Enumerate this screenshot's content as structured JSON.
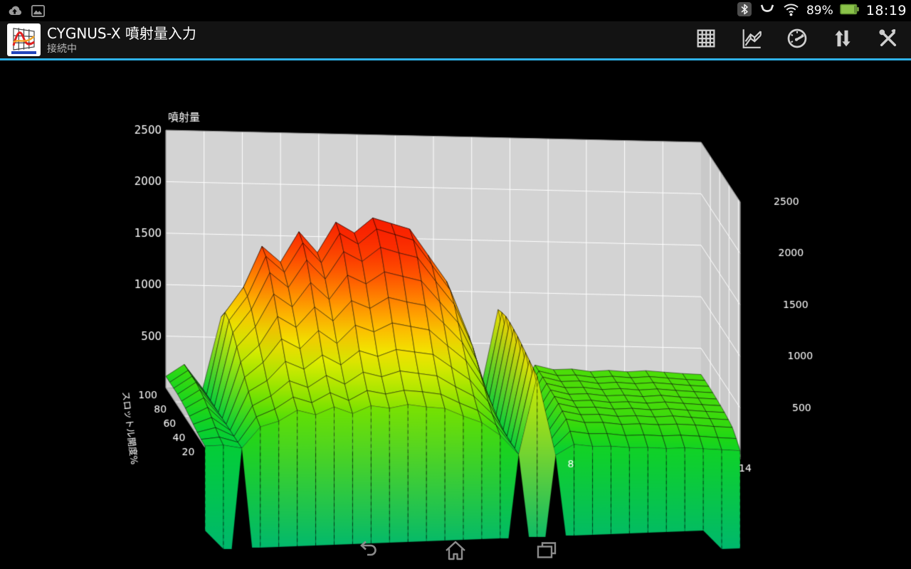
{
  "status_bar": {
    "time": "18:19",
    "battery_percent": "89%",
    "left_icons": [
      "cloud-upload",
      "gallery"
    ],
    "right_icons": [
      "bluetooth",
      "connected-device",
      "wifi",
      "battery"
    ]
  },
  "app_bar": {
    "title": "CYGNUS-X 噴射量入力",
    "subtitle": "接続中",
    "accent_color": "#2fb2e8",
    "actions": [
      {
        "name": "table-view",
        "icon": "grid-icon"
      },
      {
        "name": "surface-chart-view",
        "icon": "surface-chart-icon"
      },
      {
        "name": "gauge-view",
        "icon": "gauge-icon"
      },
      {
        "name": "transfer-data",
        "icon": "up-down-arrows-icon"
      },
      {
        "name": "settings-tools",
        "icon": "tools-icon"
      }
    ]
  },
  "nav_bar": {
    "buttons": [
      "back",
      "home",
      "recents"
    ]
  },
  "chart_data": {
    "type": "surface",
    "title": "噴射量",
    "value_axis": {
      "label": "噴射量",
      "ticks": [
        2500,
        2000,
        1500,
        1000,
        500
      ],
      "min": 0,
      "max": 2500
    },
    "rpm_axis": {
      "ticks": [
        {
          "label": "8",
          "frac": 0.674
        },
        {
          "label": "14",
          "frac": 1.0
        }
      ],
      "gridline_count": 14
    },
    "throttle_axis": {
      "label": "スロットル開度%",
      "ticks": [
        100,
        80,
        60,
        40,
        20
      ]
    },
    "throttle_rows": [
      100,
      90,
      80,
      70,
      60,
      50,
      40,
      30,
      20,
      10,
      0
    ],
    "values": [
      [
        110,
        230,
        0,
        700,
        920,
        1280,
        1140,
        1410,
        1230,
        1500,
        1410,
        1540,
        1500,
        1450,
        1230,
        1010,
        620,
        0,
        830,
        0,
        300,
        260,
        270,
        250,
        265,
        255,
        270,
        260,
        250,
        245
      ],
      [
        110,
        230,
        0,
        800,
        1050,
        1450,
        1300,
        1600,
        1400,
        1700,
        1600,
        1750,
        1700,
        1650,
        1400,
        1150,
        700,
        0,
        860,
        0,
        300,
        260,
        270,
        250,
        265,
        255,
        270,
        260,
        250,
        245
      ],
      [
        110,
        230,
        0,
        780,
        1020,
        1410,
        1260,
        1550,
        1360,
        1650,
        1550,
        1700,
        1650,
        1600,
        1360,
        1120,
        680,
        0,
        880,
        0,
        300,
        260,
        270,
        250,
        265,
        255,
        270,
        260,
        250,
        245
      ],
      [
        110,
        230,
        0,
        720,
        950,
        1310,
        1170,
        1440,
        1260,
        1530,
        1440,
        1580,
        1530,
        1490,
        1260,
        1040,
        630,
        0,
        880,
        0,
        295,
        258,
        266,
        248,
        262,
        252,
        266,
        256,
        248,
        242
      ],
      [
        100,
        215,
        0,
        640,
        840,
        1160,
        1040,
        1280,
        1120,
        1360,
        1280,
        1400,
        1360,
        1320,
        1120,
        920,
        560,
        0,
        870,
        0,
        290,
        252,
        262,
        245,
        256,
        246,
        262,
        250,
        244,
        238
      ],
      [
        90,
        195,
        0,
        550,
        720,
        1000,
        900,
        1100,
        970,
        1170,
        1100,
        1210,
        1170,
        1140,
        970,
        790,
        480,
        0,
        860,
        0,
        285,
        246,
        256,
        240,
        250,
        240,
        256,
        246,
        238,
        232
      ],
      [
        70,
        160,
        0,
        460,
        610,
        840,
        750,
        930,
        810,
        990,
        930,
        1020,
        990,
        960,
        810,
        670,
        410,
        0,
        840,
        0,
        275,
        240,
        248,
        232,
        244,
        234,
        248,
        238,
        230,
        224
      ],
      [
        50,
        120,
        0,
        380,
        490,
        680,
        610,
        750,
        660,
        800,
        750,
        820,
        800,
        780,
        660,
        540,
        330,
        0,
        820,
        0,
        260,
        228,
        236,
        220,
        230,
        222,
        236,
        226,
        218,
        212
      ],
      [
        30,
        80,
        0,
        300,
        400,
        550,
        490,
        610,
        530,
        650,
        610,
        670,
        650,
        630,
        530,
        440,
        270,
        0,
        800,
        0,
        240,
        210,
        215,
        200,
        210,
        205,
        215,
        210,
        200,
        195
      ],
      [
        20,
        45,
        0,
        250,
        330,
        450,
        400,
        500,
        430,
        530,
        500,
        540,
        530,
        510,
        430,
        360,
        220,
        0,
        780,
        0,
        180,
        160,
        165,
        150,
        160,
        155,
        165,
        160,
        150,
        145
      ],
      [
        12,
        25,
        0,
        210,
        270,
        380,
        340,
        420,
        360,
        440,
        420,
        460,
        440,
        430,
        360,
        300,
        180,
        0,
        760,
        0,
        110,
        95,
        100,
        90,
        95,
        90,
        100,
        95,
        90,
        85
      ]
    ],
    "colormap": [
      [
        0,
        "#00cd3c"
      ],
      [
        150,
        "#1ed714"
      ],
      [
        350,
        "#6ee100"
      ],
      [
        550,
        "#b4e600"
      ],
      [
        750,
        "#eeee00"
      ],
      [
        950,
        "#ffc300"
      ],
      [
        1150,
        "#ff8c00"
      ],
      [
        1350,
        "#ff5500"
      ],
      [
        1550,
        "#fc2d00"
      ],
      [
        1800,
        "#f51900"
      ]
    ],
    "colors": {
      "background": "#000000",
      "back_wall": "#d3d3d3",
      "right_wall": "#c9c9c9",
      "floor": "#c3c3c3",
      "grid_line": "#ffffff",
      "mesh_line": "rgba(0,0,0,0.72)",
      "curtain_bottom": "#00b86e",
      "label": "#ffffff"
    }
  }
}
